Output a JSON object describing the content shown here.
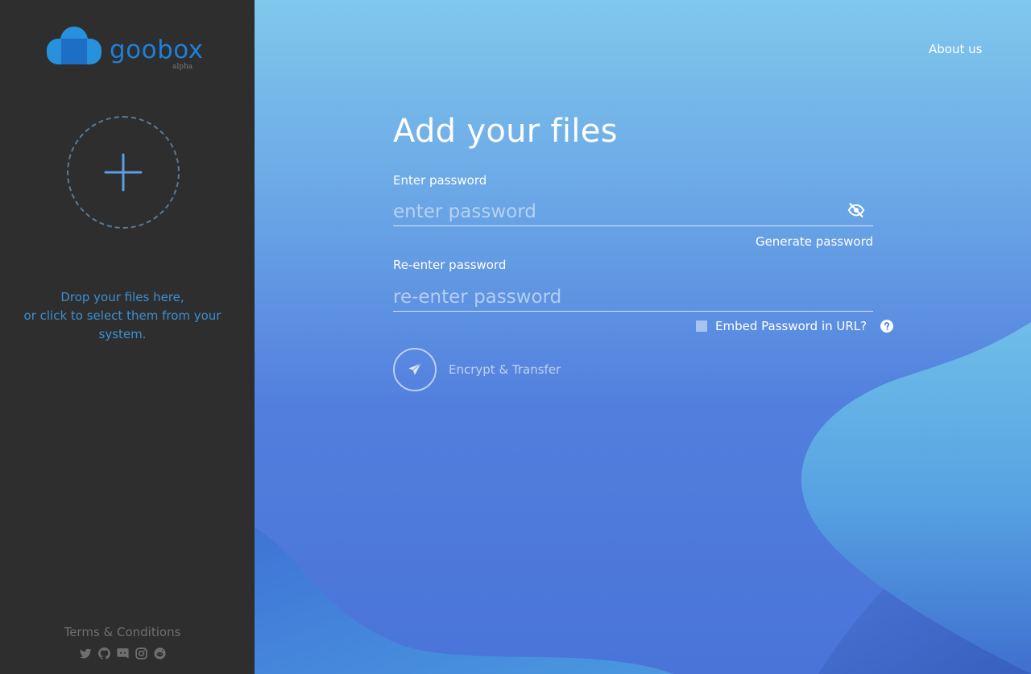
{
  "sidebar": {
    "logo": {
      "brand": "goobox",
      "subtitle": "alpha"
    },
    "dropzone": {
      "line1": "Drop your files here,",
      "line2": "or click to select them from your",
      "line3": "system."
    },
    "terms_label": "Terms & Conditions",
    "social_icons": [
      "twitter-icon",
      "github-icon",
      "discord-icon",
      "instagram-icon",
      "reddit-icon"
    ]
  },
  "header": {
    "about_label": "About us"
  },
  "form": {
    "title": "Add your files",
    "password_label": "Enter password",
    "password_placeholder": "enter password",
    "generate_label": "Generate password",
    "reenter_label": "Re-enter password",
    "reenter_placeholder": "re-enter password",
    "embed_label": "Embed Password in URL?",
    "submit_label": "Encrypt & Transfer"
  },
  "colors": {
    "sidebar_bg": "#2e2e2e",
    "brand_blue": "#1f7fd8",
    "dropzone_text": "#3b8fd1",
    "main_gradient_top": "#80c8ec",
    "main_gradient_bottom": "#4a74d8"
  }
}
